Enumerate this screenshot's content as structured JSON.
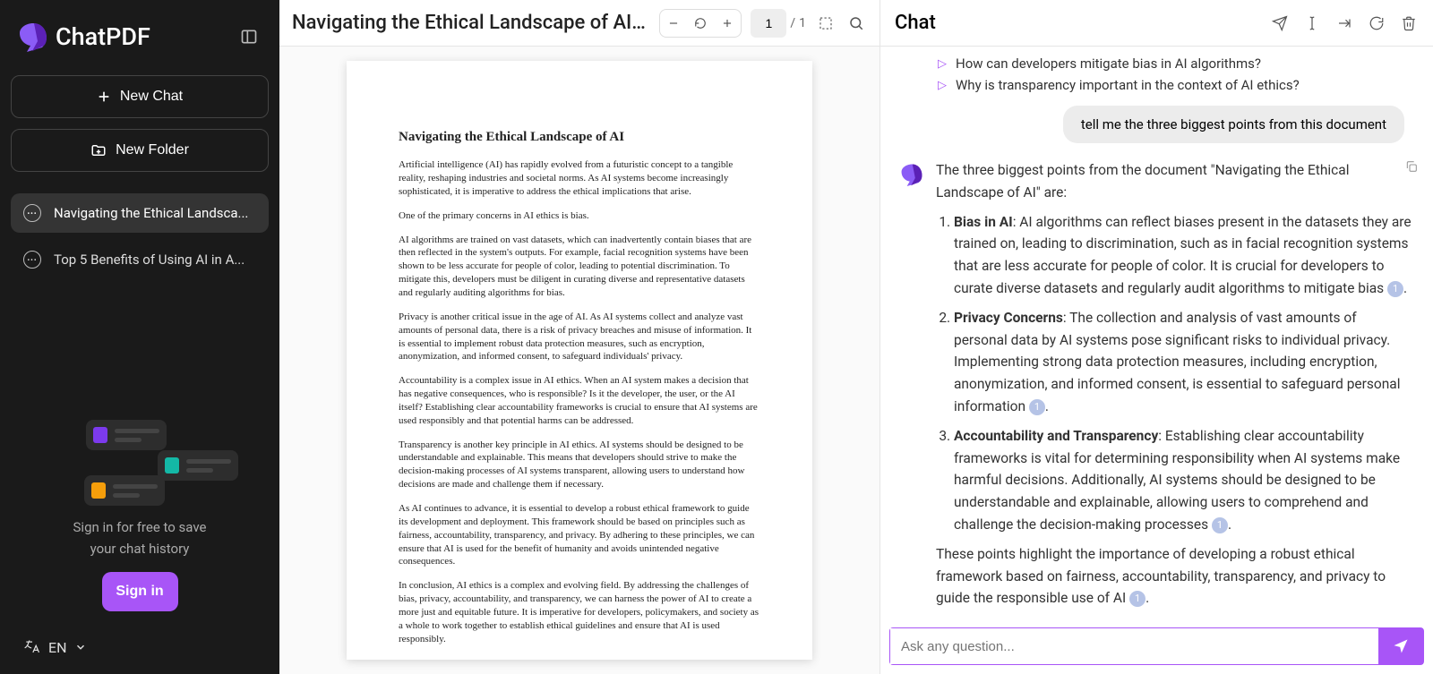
{
  "app": {
    "name": "ChatPDF"
  },
  "sidebar": {
    "new_chat": "New Chat",
    "new_folder": "New Folder",
    "chats": [
      {
        "label": "Navigating the Ethical Landsca..."
      },
      {
        "label": "Top 5 Benefits of Using AI in A..."
      }
    ],
    "promo_line1": "Sign in for free to save",
    "promo_line2": "your chat history",
    "signin": "Sign in",
    "lang": "EN"
  },
  "pdf": {
    "title": "Navigating the Ethical Landscape of AI....",
    "page_current": "1",
    "page_sep": "/",
    "page_total": "1",
    "doc_title": "Navigating the Ethical Landscape of AI",
    "paragraphs": [
      "Artificial intelligence (AI) has rapidly evolved from a futuristic concept to a tangible reality, reshaping industries and societal norms. As AI systems become increasingly sophisticated, it is imperative to address the ethical implications that arise.",
      "One of the primary concerns in AI ethics is bias.",
      "AI algorithms are trained on vast datasets, which can inadvertently contain biases that are then reflected in the system's outputs. For example, facial recognition systems have been shown to be less accurate for people of color, leading to potential discrimination. To mitigate this, developers must be diligent in curating diverse and representative datasets and regularly auditing algorithms for bias.",
      "Privacy is another critical issue in the age of AI. As AI systems collect and analyze vast amounts of personal data, there is a risk of privacy breaches and misuse of information. It is essential to implement robust data protection measures, such as encryption, anonymization, and informed consent, to safeguard individuals' privacy.",
      "Accountability is a complex issue in AI ethics. When an AI system makes a decision that has negative consequences, who is responsible? Is it the developer, the user, or the AI itself? Establishing clear accountability frameworks is crucial to ensure that AI systems are used responsibly and that potential harms can be addressed.",
      "Transparency is another key principle in AI ethics. AI systems should be designed to be understandable and explainable. This means that developers should strive to make the decision-making processes of AI systems transparent, allowing users to understand how decisions are made and challenge them if necessary.",
      "As AI continues to advance, it is essential to develop a robust ethical framework to guide its development and deployment. This framework should be based on principles such as fairness, accountability, transparency, and privacy. By adhering to these principles, we can ensure that AI is used for the benefit of humanity and avoids unintended negative consequences.",
      "In conclusion, AI ethics is a complex and evolving field. By addressing the challenges of bias, privacy, accountability, and transparency, we can harness the power of AI to create a more just and equitable future. It is imperative for developers, policymakers, and society as a whole to work together to establish ethical guidelines and ensure that AI is used responsibly."
    ]
  },
  "chat": {
    "header": "Chat",
    "suggestions": [
      "How can developers mitigate bias in AI algorithms?",
      "Why is transparency important in the context of AI ethics?"
    ],
    "user_msg": "tell me the three biggest points from this document",
    "ai_intro": "The three biggest points from the document \"Navigating the Ethical Landscape of AI\" are:",
    "points": [
      {
        "title": "Bias in AI",
        "body": ": AI algorithms can reflect biases present in the datasets they are trained on, leading to discrimination, such as in facial recognition systems that are less accurate for people of color. It is crucial for developers to curate diverse datasets and regularly audit algorithms to mitigate bias ",
        "cite": "1",
        "after": "."
      },
      {
        "title": "Privacy Concerns",
        "body": ": The collection and analysis of vast amounts of personal data by AI systems pose significant risks to individual privacy. Implementing strong data protection measures, including encryption, anonymization, and informed consent, is essential to safeguard personal information ",
        "cite": "1",
        "after": "."
      },
      {
        "title": "Accountability and Transparency",
        "body": ": Establishing clear accountability frameworks is vital for determining responsibility when AI systems make harmful decisions. Additionally, AI systems should be designed to be understandable and explainable, allowing users to comprehend and challenge the decision-making processes ",
        "cite": "1",
        "after": "."
      }
    ],
    "ai_outro_pre": "These points highlight the importance of developing a robust ethical framework based on fairness, accountability, transparency, and privacy to guide the responsible use of AI ",
    "ai_outro_cite": "1",
    "ai_outro_after": ".",
    "input_placeholder": "Ask any question..."
  }
}
